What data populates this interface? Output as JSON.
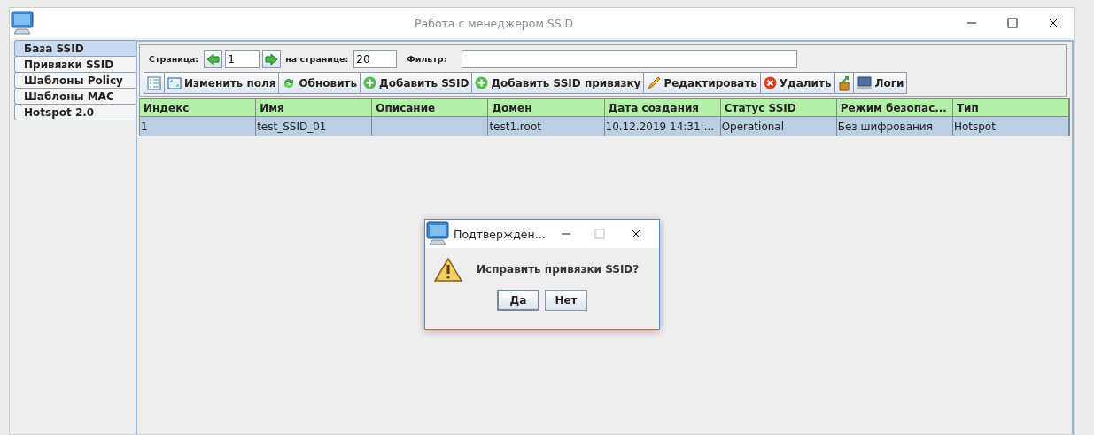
{
  "window": {
    "title": "Работа с менеджером SSID"
  },
  "sidebar": {
    "items": [
      {
        "label": "База SSID",
        "selected": true
      },
      {
        "label": "Привязки SSID",
        "selected": false
      },
      {
        "label": "Шаблоны Policy",
        "selected": false
      },
      {
        "label": "Шаблоны MAC",
        "selected": false
      },
      {
        "label": "Hotspot 2.0",
        "selected": false
      }
    ]
  },
  "paging": {
    "page_label": "Страница:",
    "page": "1",
    "per_page_label": "на странице:",
    "per_page": "20",
    "filter_label": "Фильтр:"
  },
  "toolbar": [
    {
      "kind": "columns"
    },
    {
      "kind": "fields",
      "label": "Изменить поля"
    },
    {
      "kind": "refresh",
      "label": "Обновить"
    },
    {
      "kind": "add",
      "label": "Добавить SSID"
    },
    {
      "kind": "add",
      "label": "Добавить SSID привязку"
    },
    {
      "kind": "edit",
      "label": "Редактировать"
    },
    {
      "kind": "delete",
      "label": "Удалить"
    },
    {
      "kind": "export"
    },
    {
      "kind": "logs",
      "label": "Логи"
    }
  ],
  "table": {
    "columns": [
      "Индекс",
      "Имя",
      "Описание",
      "Домен",
      "Дата создания",
      "Статус SSID",
      "Режим безопас...",
      "Тип"
    ],
    "rows": [
      {
        "selected": true,
        "cells": [
          "1",
          "test_SSID_01",
          "",
          "test1.root",
          "10.12.2019 14:31:...",
          "Operational",
          "Без шифрования",
          "Hotspot"
        ]
      }
    ]
  },
  "dialog": {
    "title": "Подтвержден...",
    "message": "Исправить привязки SSID?",
    "buttons": [
      {
        "label": "Да",
        "selected": true
      },
      {
        "label": "Нет",
        "selected": false
      }
    ]
  }
}
